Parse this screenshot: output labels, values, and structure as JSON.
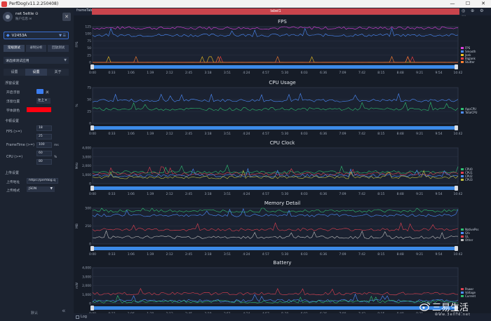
{
  "window": {
    "title": "PerfDog(v11.2.250408)",
    "controls": [
      "—",
      "☐",
      "✕"
    ]
  },
  "sidebar": {
    "user": {
      "name": "net 5eltle ⊙",
      "subtitle": "账户信息 ✉",
      "close": "✕"
    },
    "device": {
      "name": "V2453A",
      "icons": "▼ ☰"
    },
    "mode_tabs": [
      {
        "label": "常规测试",
        "active": true
      },
      {
        "label": "录制分析",
        "active": false
      },
      {
        "label": "回放测试",
        "active": false
      }
    ],
    "app_select": {
      "label": "请选择测试应用",
      "caret": "▼"
    },
    "settings_tabs": [
      {
        "label": "设置",
        "active": false
      },
      {
        "label": "设置",
        "active": true
      },
      {
        "label": "关于",
        "active": false
      }
    ],
    "float": {
      "section": "浮窗设置",
      "open_label": "开启浮窗",
      "toggle_text": "关",
      "position_label": "浮窗位置",
      "position_value": "左上 ▾",
      "font_color_label": "字体颜色",
      "font_color": "#ff0010"
    },
    "alarm": {
      "section": "卡顿设置",
      "fps_label": "FPS (>=)",
      "fps_value1": "18",
      "fps_value2": "25",
      "frametime_label": "FrameTime (>=)",
      "frametime_value": "100",
      "frametime_unit": "ms",
      "cpu_label": "CPU (>=)",
      "cpu_value1": "60",
      "cpu_value2": "80",
      "cpu_unit": "%"
    },
    "upload": {
      "section": "上传设置",
      "address_label": "上传地址",
      "address_value": "https://perfdog.q",
      "format_label": "上传格式",
      "format_value": "JSON",
      "format_caret": "▼"
    },
    "default_button": "默认",
    "collapse_icon": "«"
  },
  "main": {
    "tab_name": "frameTab",
    "label_bar": "label1",
    "tabbar_icons": "◎ ⊕ ⚙ ⋯"
  },
  "x_ticks": [
    "0:00",
    "0:33",
    "1:06",
    "1:39",
    "2:12",
    "2:45",
    "3:18",
    "3:51",
    "4:24",
    "4:57",
    "5:30",
    "6:03",
    "6:36",
    "7:09",
    "7:42",
    "8:15",
    "8:48",
    "9:21",
    "9:54",
    "10:42"
  ],
  "chart_data": [
    {
      "type": "line",
      "title": "FPS",
      "ylabel": "FPS",
      "ylim": [
        0,
        125
      ],
      "yticks": [
        "125",
        "100",
        "75",
        "50",
        "25",
        "0"
      ],
      "series": [
        {
          "name": "FPS",
          "color": "#e040e0",
          "level": 120
        },
        {
          "name": "Smooth",
          "color": "#4d8eff",
          "level": 95
        },
        {
          "name": "Jank",
          "color": "#f0c020",
          "level": 0
        },
        {
          "name": "BigJank",
          "color": "#ff4040",
          "level": 0
        },
        {
          "name": "Stutter",
          "color": "#ff8030",
          "level": 0
        }
      ]
    },
    {
      "type": "line",
      "title": "CPU Usage",
      "ylabel": "%",
      "ylim": [
        0,
        75
      ],
      "yticks": [
        "75",
        "50",
        "25",
        "0"
      ],
      "series": [
        {
          "name": "AppCPU",
          "color": "#2fbf71",
          "level": 30
        },
        {
          "name": "TotalCPU",
          "color": "#4d8eff",
          "level": 48
        }
      ]
    },
    {
      "type": "line",
      "title": "CPU Clock",
      "ylabel": "MHz",
      "ylim": [
        0,
        4000
      ],
      "yticks": [
        "4,000",
        "3,000",
        "2,000",
        "1,000",
        "0"
      ],
      "series": [
        {
          "name": "CPU0",
          "color": "#2fbf71",
          "level": 1300
        },
        {
          "name": "CPU1",
          "color": "#e04050",
          "level": 1100
        },
        {
          "name": "CPU2",
          "color": "#4d8eff",
          "level": 900
        },
        {
          "name": "CPU3",
          "color": "#c0c040",
          "level": 700
        }
      ]
    },
    {
      "type": "line",
      "title": "Memory Detail",
      "ylabel": "MB",
      "ylim": [
        0,
        650
      ],
      "yticks": [
        "500",
        "250",
        "0"
      ],
      "series": [
        {
          "name": "NativePss",
          "color": "#2fbf71",
          "level": 600
        },
        {
          "name": "Gfx",
          "color": "#4d8eff",
          "level": 520
        },
        {
          "name": "GL",
          "color": "#e04050",
          "level": 260
        },
        {
          "name": "Other",
          "color": "#c0c0c0",
          "level": 120
        }
      ]
    },
    {
      "type": "line",
      "title": "Battery",
      "ylabel": "mW",
      "ylim": [
        0,
        4000
      ],
      "yticks": [
        "4,000",
        "3,000",
        "2,000",
        "1,000",
        "0"
      ],
      "series": [
        {
          "name": "Power",
          "color": "#e04050",
          "level": 1100
        },
        {
          "name": "Voltage",
          "color": "#4d8eff",
          "level": 300
        },
        {
          "name": "Current",
          "color": "#2fbf71",
          "level": 200
        }
      ]
    }
  ],
  "log_label": "Log",
  "watermark": {
    "brand": "三易生活",
    "sub": "www.3elife.net"
  }
}
